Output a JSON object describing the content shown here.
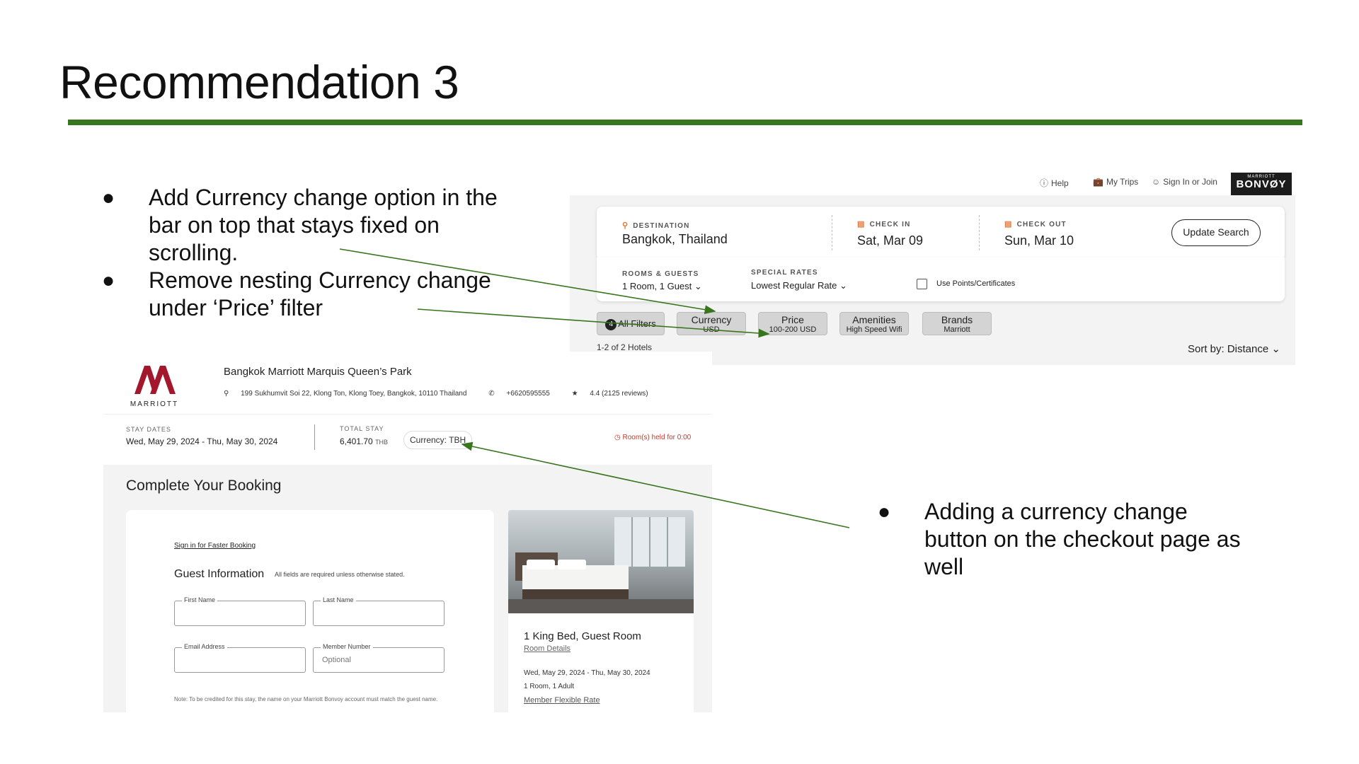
{
  "slide": {
    "title": "Recommendation 3",
    "bullets_left": [
      "Add Currency change option in the bar on top that stays fixed on scrolling.",
      "Remove nesting Currency change under ‘Price’ filter"
    ],
    "bullet_right": "Adding a currency change button on the checkout page as well",
    "bullet_glyph": "●"
  },
  "search_page": {
    "top_links": {
      "help": "Help",
      "my_trips": "My Trips",
      "sign_in": "Sign In or Join"
    },
    "brand": {
      "small": "MARRIOTT",
      "big": "BONVØY"
    },
    "destination": {
      "label": "DESTINATION",
      "value": "Bangkok, Thailand"
    },
    "check_in": {
      "label": "CHECK IN",
      "value": "Sat, Mar 09"
    },
    "check_out": {
      "label": "CHECK OUT",
      "value": "Sun, Mar 10"
    },
    "update_button": "Update Search",
    "rooms_guests": {
      "label": "ROOMS & GUESTS",
      "value": "1 Room, 1 Guest ⌄"
    },
    "special_rates": {
      "label": "SPECIAL RATES",
      "value": "Lowest Regular Rate ⌄"
    },
    "use_points_label": "Use Points/Certificates",
    "filters": {
      "all_filters": {
        "badge": "4",
        "label": "All Filters"
      },
      "currency": {
        "label": "Currency",
        "sub": "USD"
      },
      "price": {
        "label": "Price",
        "sub": "100-200 USD"
      },
      "amenities": {
        "label": "Amenities",
        "sub": "High Speed Wifi"
      },
      "brands": {
        "label": "Brands",
        "sub": "Marriott"
      }
    },
    "hotel_count": "1-2 of 2 Hotels",
    "sort_by": "Sort by: Distance ⌄"
  },
  "checkout_page": {
    "logo_word": "MARRIOTT",
    "hotel_name": "Bangkok Marriott Marquis Queen’s Park",
    "address": "199 Sukhumvit Soi 22, Klong Ton, Klong Toey, Bangkok, 10110 Thailand",
    "phone": "+6620595555",
    "rating": "4.4 (2125 reviews)",
    "stay_dates": {
      "label": "STAY DATES",
      "value": "Wed, May 29, 2024 - Thu, May 30, 2024"
    },
    "total_stay": {
      "label": "TOTAL STAY",
      "value": "6,401.70",
      "currency": "THB"
    },
    "currency_button": "Currency: TBH",
    "room_held": "Room(s) held for 0:00",
    "complete_title": "Complete Your Booking",
    "signin_link": "Sign in for Faster Booking",
    "guest_info_title": "Guest Information",
    "guest_info_note": "All fields are required unless otherwise stated.",
    "fields": {
      "first_name": "First Name",
      "last_name": "Last Name",
      "email": "Email Address",
      "member_number": "Member Number",
      "member_placeholder": "Optional"
    },
    "form_note": "Note: To be credited for this stay, the name on your Marriott Bonvoy account must match the guest name.",
    "room": {
      "title": "1 King Bed, Guest Room",
      "details_link": "Room Details",
      "dates": "Wed, May 29, 2024 - Thu, May 30, 2024",
      "occupancy": "1 Room, 1 Adult",
      "rate_link": "Member Flexible Rate"
    }
  },
  "colors": {
    "accent_green": "#38761d",
    "marriott_red": "#a3172d",
    "calendar_orange": "#e07b39",
    "alert_red": "#c0392b"
  }
}
